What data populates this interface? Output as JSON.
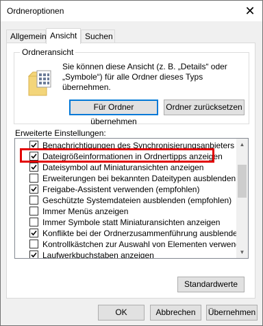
{
  "window": {
    "title": "Ordneroptionen",
    "close_glyph": "✕"
  },
  "tabs": [
    {
      "label": "Allgemein",
      "active": false
    },
    {
      "label": "Ansicht",
      "active": true
    },
    {
      "label": "Suchen",
      "active": false
    }
  ],
  "folder_view": {
    "group_label": "Ordneransicht",
    "description": "Sie können diese Ansicht (z. B. „Details“ oder „Symbole“) für alle Ordner dieses Typs übernehmen.",
    "apply_button": "Für Ordner übernehmen",
    "reset_button": "Ordner zurücksetzen",
    "icon": "folder-icon"
  },
  "advanced": {
    "label": "Erweiterte Einstellungen:",
    "items": [
      {
        "label": "Benachrichtigungen des Synchronisierungsanbieters anzeigen",
        "checked": true
      },
      {
        "label": "Dateigrößeinformationen in Ordnertipps anzeigen",
        "checked": true
      },
      {
        "label": "Dateisymbol auf Miniaturansichten anzeigen",
        "checked": true
      },
      {
        "label": "Erweiterungen bei bekannten Dateitypen ausblenden",
        "checked": false
      },
      {
        "label": "Freigabe-Assistent verwenden (empfohlen)",
        "checked": true
      },
      {
        "label": "Geschützte Systemdateien ausblenden (empfohlen)",
        "checked": false
      },
      {
        "label": "Immer Menüs anzeigen",
        "checked": false
      },
      {
        "label": "Immer Symbole statt Miniaturansichten anzeigen",
        "checked": false
      },
      {
        "label": "Konflikte bei der Ordnerzusammenführung ausblenden",
        "checked": true
      },
      {
        "label": "Kontrollkästchen zur Auswahl von Elementen verwenden",
        "checked": false
      },
      {
        "label": "Laufwerkbuchstaben anzeigen",
        "checked": true
      }
    ],
    "defaults_button": "Standardwerte"
  },
  "footer": {
    "ok": "OK",
    "cancel": "Abbrechen",
    "apply": "Übernehmen"
  },
  "colors": {
    "highlight": "#e20000",
    "accent": "#0078d7"
  }
}
